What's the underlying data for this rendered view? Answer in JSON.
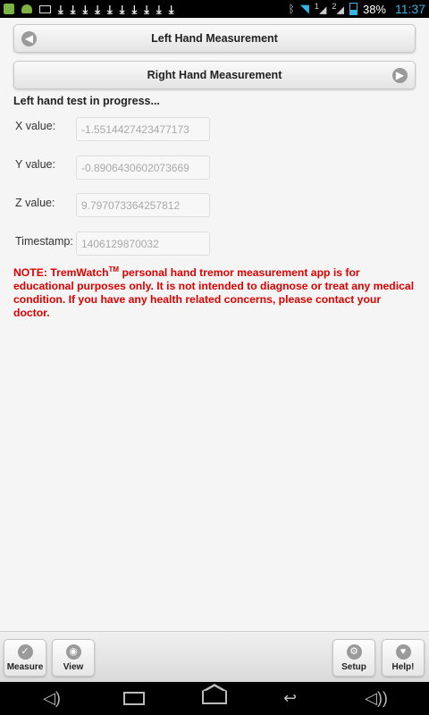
{
  "status_bar": {
    "battery_percent": "38%",
    "time": "11:37",
    "signal_1": "1",
    "signal_2": "2",
    "download_count": 10
  },
  "buttons": {
    "left_hand": "Left Hand Measurement",
    "right_hand": "Right Hand Measurement"
  },
  "status_text": "Left hand test in progress...",
  "fields": [
    {
      "label": "X value:",
      "value": "-1.5514427423477173"
    },
    {
      "label": "Y value:",
      "value": "-0.8906430602073669"
    },
    {
      "label": "Z value:",
      "value": "9.797073364257812"
    },
    {
      "label": "Timestamp:",
      "value": "1406129870032"
    }
  ],
  "note": {
    "prefix": "NOTE: TremWatch",
    "tm": "TM",
    "text": " personal hand tremor measurement app is for educational purposes only. It is not intended to diagnose or treat any medical condition. If you have any health related concerns, please contact your doctor."
  },
  "footer": {
    "measure": "Measure",
    "view": "View",
    "setup": "Setup",
    "help": "Help!"
  },
  "colors": {
    "note": "#e00000",
    "accent": "#33b5e5"
  },
  "icons": {
    "left_arrow": "arrow-left-circle-icon",
    "right_arrow": "arrow-right-circle-icon",
    "measure": "check-circle-icon",
    "view": "eye-icon",
    "setup": "gear-icon",
    "help": "heart-icon"
  }
}
